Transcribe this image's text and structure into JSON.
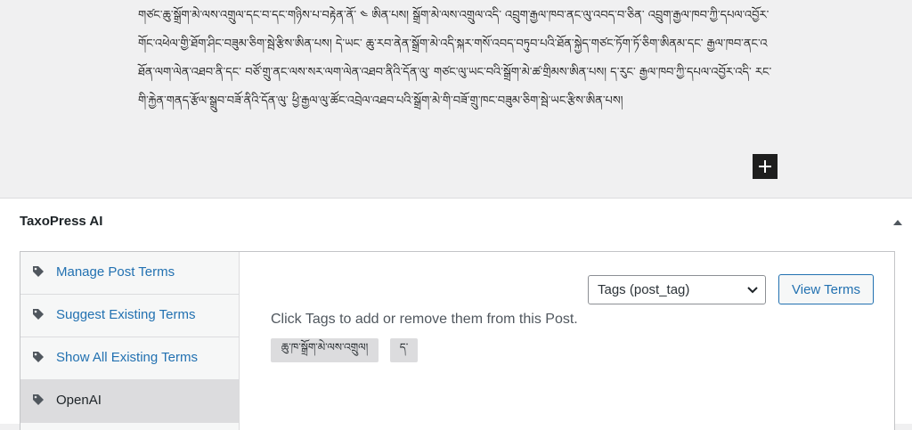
{
  "editor": {
    "paragraph": "གཙང་ཆུ་སྒྲོག་མེ་ལས་འགྲུལ་དང་བ་དང་གཉིས་པ་བརྟེན་ནོ་ ༤ ཨིན་པས། སྒྲོག་མེ་ལས་འགྲུལ་འདི་ འབྲུག་རྒྱལ་ཁབ་ནང་ལུ་འབད་བ་ཅིན་ འབྲུག་རྒྱལ་ཁབ་ཀྱི་དཔལ་འབྱོར་གོང་འཕེལ་གྱི་ཐོག་ཤིང་བཟུམ་ཅིག་སྦེ་རྩིས་ཨིན་པས། དེ་ཡང་ ཆུ་རབ་ནེན་སྒྲོག་མེ་འདི་སྐར་གསོ་འབད་བཏུབ་པའི་ཐོན་སྐྱེད་གཙང་ཏོག་ཏོ་ཅིག་ཨིནམ་དང་ རྒྱལ་ཁབ་ནང་འཐོན་ལག་ལེན་འཐབ་ནི་དང་ བཙོ་གྲུ་ནང་ལས་སར་ལག་ལེན་འཐབ་ནིའི་དོན་ལུ་ གཙང་ལུ་ཡང་བའི་སྒྲོག་མེ་ཚ་གྲིམས་ཨིན་པས། ད་རུང་ རྒྱལ་ཁབ་ཀྱི་དཔལ་འབྱོར་འདི་ རང་གི་རྐྱེན་གནད་རྩོལ་སྒྲུབ་བཟོ་ནིའི་དོན་ལུ་ ཕྱི་རྒྱལ་ལུ་ཚོང་འབྲེལ་འཐབ་པའི་སྒྲོག་མེ་གི་བཟོ་གྲུ་ཁང་བཟུམ་ཅིག་སྦེ་ཡང་རྩིས་ཨིན་པས།"
  },
  "panel": {
    "title": "TaxoPress AI",
    "tabs": [
      {
        "label": "Manage Post Terms"
      },
      {
        "label": "Suggest Existing Terms"
      },
      {
        "label": "Show All Existing Terms"
      },
      {
        "label": "OpenAI"
      }
    ],
    "active_tab": "OpenAI",
    "taxonomy_select": {
      "value": "Tags (post_tag)"
    },
    "view_terms_label": "View Terms",
    "instructions": "Click Tags to add or remove them from this Post.",
    "terms": [
      "ཆུ་ཁ་སྒྲོག་མེ་ལས་འགྲུལ།",
      "ད་"
    ]
  },
  "colors": {
    "link": "#2271b1",
    "editor_bg": "#f0f0f1",
    "active_tab_bg": "#dcdcde",
    "chip_bg": "#dcdcde"
  },
  "icons": {
    "add_block": "plus-icon",
    "toggle": "caret-up-icon",
    "tab": "tag-icon",
    "select": "chevron-down-icon"
  }
}
